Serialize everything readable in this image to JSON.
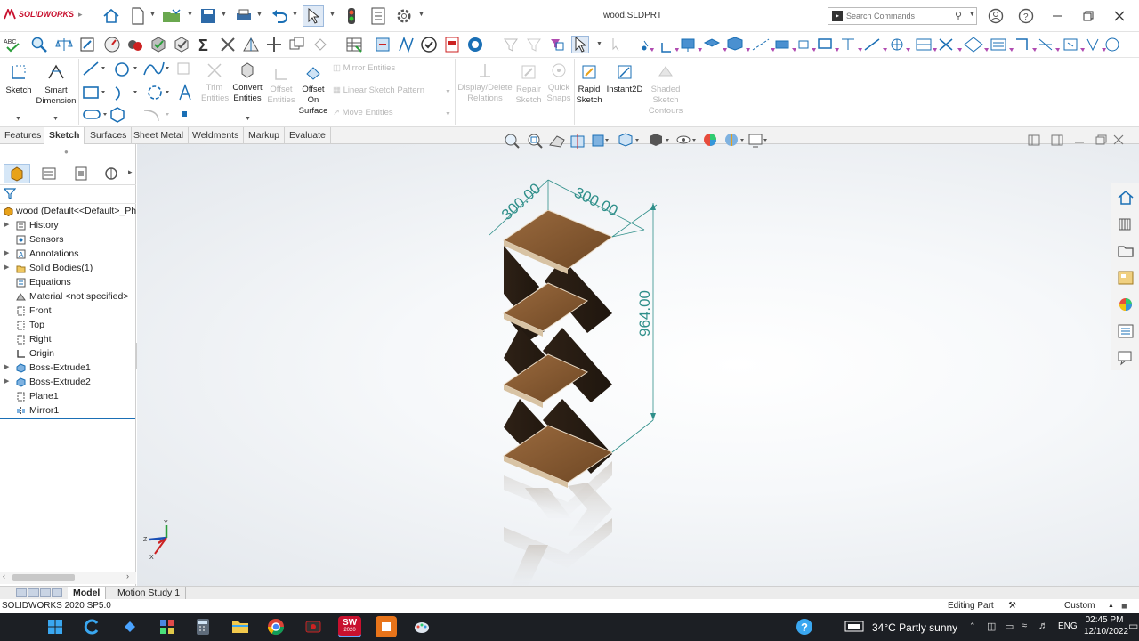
{
  "app": {
    "logo_text": "SOLIDWORKS",
    "file_title": "wood.SLDPRT"
  },
  "search": {
    "placeholder": "Search Commands"
  },
  "ribbon": {
    "sketch": "Sketch",
    "smart_dimension_1": "Smart",
    "smart_dimension_2": "Dimension",
    "trim_1": "Trim",
    "trim_2": "Entities",
    "convert_1": "Convert",
    "convert_2": "Entities",
    "offset_1": "Offset",
    "offset_2": "Entities",
    "offset_surface_1": "Offset",
    "offset_surface_2": "On",
    "offset_surface_3": "Surface",
    "mirror": "Mirror Entities",
    "linear_pattern": "Linear Sketch Pattern",
    "move": "Move Entities",
    "display_delete_1": "Display/Delete",
    "display_delete_2": "Relations",
    "repair_1": "Repair",
    "repair_2": "Sketch",
    "quick_snaps_1": "Quick",
    "quick_snaps_2": "Snaps",
    "rapid_1": "Rapid",
    "rapid_2": "Sketch",
    "instant2d": "Instant2D",
    "shaded_1": "Shaded",
    "shaded_2": "Sketch",
    "shaded_3": "Contours"
  },
  "tabs": [
    "Features",
    "Sketch",
    "Surfaces",
    "Sheet Metal",
    "Weldments",
    "Markup",
    "Evaluate"
  ],
  "active_tab": "Sketch",
  "tree": {
    "root": "wood  (Default<<Default>_Ph",
    "items": [
      "History",
      "Sensors",
      "Annotations",
      "Solid Bodies(1)",
      "Equations",
      "Material <not specified>",
      "Front",
      "Top",
      "Right",
      "Origin",
      "Boss-Extrude1",
      "Boss-Extrude2",
      "Plane1",
      "Mirror1"
    ]
  },
  "dimensions": {
    "width_a": "300.00",
    "width_b": "300.00",
    "height": "964.00"
  },
  "triad": {
    "x": "X",
    "y": "Y",
    "z": "Z"
  },
  "bottom_tabs": [
    "Model",
    "Motion Study 1"
  ],
  "status": {
    "version": "SOLIDWORKS 2020 SP5.0",
    "mode": "Editing Part",
    "units": "Custom"
  },
  "taskbar": {
    "weather": "34°C  Partly sunny",
    "lang": "ENG",
    "time": "02:45 PM",
    "date": "12/10/2022",
    "sw_badge": "SW",
    "sw_year": "2020"
  },
  "colors": {
    "accent": "#1a6fb5",
    "dimension": "#2f8f8a",
    "wood_top": "#8a5a33",
    "wood_dark": "#2a1e14",
    "taskbar": "#1c1f24"
  }
}
